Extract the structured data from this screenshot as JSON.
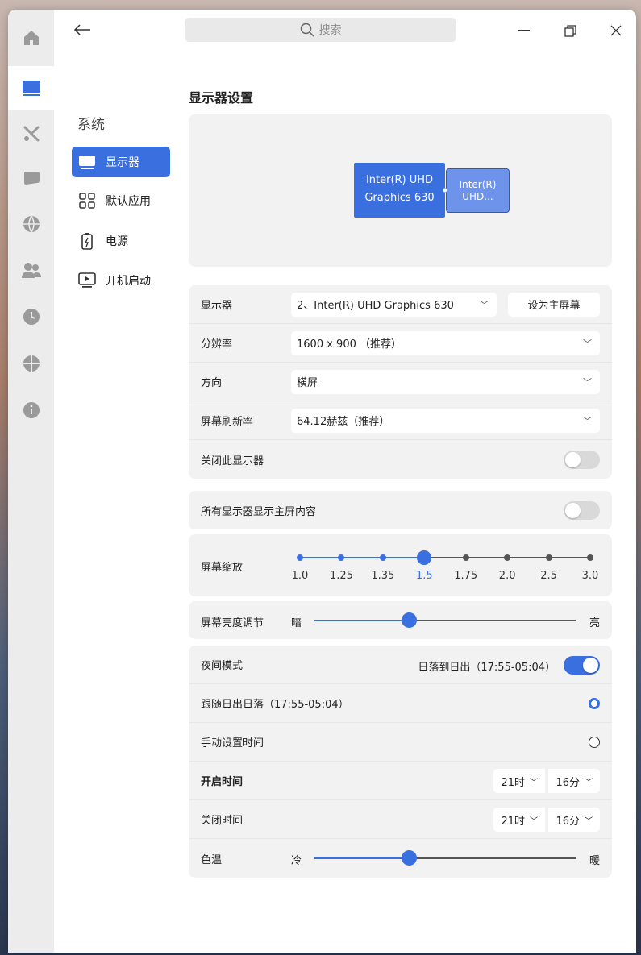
{
  "search": {
    "placeholder": "搜索"
  },
  "sidebar": {
    "section_title": "系统",
    "items": [
      {
        "label": "显示器",
        "icon": "monitor-icon",
        "active": true
      },
      {
        "label": "默认应用",
        "icon": "grid-apps-icon",
        "active": false
      },
      {
        "label": "电源",
        "icon": "battery-icon",
        "active": false
      },
      {
        "label": "开机启动",
        "icon": "startup-play-icon",
        "active": false
      }
    ]
  },
  "rail": [
    "home-icon",
    "display-icon",
    "tools-icon",
    "chat-icon",
    "globe-icon",
    "users-icon",
    "clock-icon",
    "compass-icon",
    "info-icon"
  ],
  "main": {
    "title": "显示器设置",
    "preview": {
      "monitor1_line1": "Inter(R) UHD",
      "monitor1_line2": "Graphics 630",
      "monitor2_line1": "Inter(R)",
      "monitor2_line2": "UHD..."
    },
    "display": {
      "label": "显示器",
      "value": "2、Inter(R) UHD Graphics 630",
      "set_primary": "设为主屏幕"
    },
    "resolution": {
      "label": "分辨率",
      "value": "1600 x 900 （推荐）"
    },
    "orientation": {
      "label": "方向",
      "value": "横屏"
    },
    "refresh": {
      "label": "屏幕刷新率",
      "value": "64.12赫兹（推荐）"
    },
    "turn_off": {
      "label": "关闭此显示器",
      "on": false
    },
    "mirror": {
      "label": "所有显示器显示主屏内容",
      "on": false
    },
    "scale": {
      "label": "屏幕缩放",
      "options": [
        "1.0",
        "1.25",
        "1.35",
        "1.5",
        "1.75",
        "2.0",
        "2.5",
        "3.0"
      ],
      "selected_index": 3
    },
    "brightness": {
      "label": "屏幕亮度调节",
      "min_label": "暗",
      "max_label": "亮",
      "value": 0.36
    },
    "night": {
      "label": "夜间模式",
      "status": "日落到日出（17:55-05:04）",
      "on": true,
      "follow_label": "跟随日出日落（17:55-05:04）",
      "manual_label": "手动设置时间",
      "mode": "follow",
      "start_label": "开启时间",
      "start_hour": "21时",
      "start_min": "16分",
      "end_label": "关闭时间",
      "end_hour": "21时",
      "end_min": "16分"
    },
    "temperature": {
      "label": "色温",
      "min_label": "冷",
      "max_label": "暖",
      "value": 0.36
    }
  },
  "colors": {
    "accent": "#3a6fe0",
    "panel": "#f2f2f2"
  }
}
